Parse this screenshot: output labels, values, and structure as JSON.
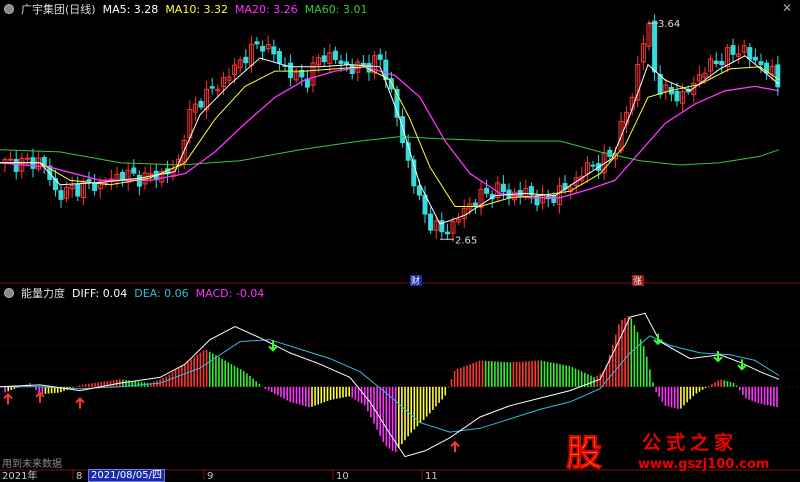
{
  "main_legend": {
    "title": "广宇集团(日线)",
    "ma5": "MA5: 3.28",
    "ma10": "MA10: 3.32",
    "ma20": "MA20: 3.26",
    "ma60": "MA60: 3.01"
  },
  "indicator_legend": {
    "name": "能量力度",
    "diff": "DIFF: 0.04",
    "dea": "DEA: 0.06",
    "macd": "MACD: -0.04"
  },
  "annotations": {
    "high": "3.64",
    "low": "2.65",
    "cai_badge": "财",
    "zhang_badge": "涨"
  },
  "footnote": "用到未来数据",
  "x_axis": {
    "year": "2021年",
    "m8": "8",
    "m9": "9",
    "m10": "10",
    "m11": "11",
    "crosshair_date": "2021/08/05/四"
  },
  "logo": {
    "stock_char": "股",
    "title": "公式之家",
    "url": "www.gszj100.com"
  },
  "colors": {
    "ma5": "#ffffff",
    "ma10": "#ffff33",
    "ma20": "#ff33ff",
    "ma60": "#33cc33",
    "up": "#ff3333",
    "down": "#33dddd",
    "diff": "#ffffff",
    "dea": "#33bbdd"
  },
  "chart_data": [
    {
      "type": "candlestick",
      "title": "广宇集团(日线)",
      "ylim": [
        2.5,
        3.7
      ],
      "price_path": [
        [
          0,
          3.0
        ],
        [
          20,
          3.0
        ],
        [
          40,
          3.01
        ],
        [
          55,
          2.85
        ],
        [
          70,
          2.88
        ],
        [
          85,
          2.9
        ],
        [
          100,
          2.9
        ],
        [
          120,
          2.95
        ],
        [
          140,
          2.93
        ],
        [
          160,
          2.95
        ],
        [
          175,
          2.97
        ],
        [
          185,
          3.2
        ],
        [
          200,
          3.3
        ],
        [
          215,
          3.35
        ],
        [
          230,
          3.42
        ],
        [
          245,
          3.5
        ],
        [
          260,
          3.55
        ],
        [
          275,
          3.48
        ],
        [
          290,
          3.4
        ],
        [
          305,
          3.38
        ],
        [
          320,
          3.5
        ],
        [
          335,
          3.47
        ],
        [
          350,
          3.43
        ],
        [
          365,
          3.45
        ],
        [
          380,
          3.47
        ],
        [
          392,
          3.28
        ],
        [
          400,
          3.1
        ],
        [
          410,
          2.95
        ],
        [
          420,
          2.78
        ],
        [
          430,
          2.72
        ],
        [
          440,
          2.68
        ],
        [
          452,
          2.72
        ],
        [
          465,
          2.8
        ],
        [
          480,
          2.85
        ],
        [
          495,
          2.88
        ],
        [
          510,
          2.85
        ],
        [
          525,
          2.87
        ],
        [
          540,
          2.82
        ],
        [
          555,
          2.86
        ],
        [
          570,
          2.9
        ],
        [
          585,
          2.98
        ],
        [
          600,
          3.0
        ],
        [
          612,
          3.05
        ],
        [
          620,
          3.18
        ],
        [
          630,
          3.3
        ],
        [
          640,
          3.55
        ],
        [
          648,
          3.62
        ],
        [
          652,
          3.43
        ],
        [
          660,
          3.32
        ],
        [
          670,
          3.32
        ],
        [
          680,
          3.3
        ],
        [
          690,
          3.35
        ],
        [
          700,
          3.42
        ],
        [
          710,
          3.45
        ],
        [
          720,
          3.48
        ],
        [
          730,
          3.5
        ],
        [
          740,
          3.53
        ],
        [
          750,
          3.47
        ],
        [
          760,
          3.45
        ],
        [
          770,
          3.41
        ],
        [
          779,
          3.33
        ]
      ],
      "ma5": [
        [
          0,
          3.0
        ],
        [
          40,
          3.0
        ],
        [
          60,
          2.9
        ],
        [
          100,
          2.91
        ],
        [
          140,
          2.93
        ],
        [
          175,
          2.96
        ],
        [
          200,
          3.22
        ],
        [
          230,
          3.36
        ],
        [
          260,
          3.48
        ],
        [
          290,
          3.44
        ],
        [
          320,
          3.44
        ],
        [
          350,
          3.45
        ],
        [
          380,
          3.44
        ],
        [
          400,
          3.2
        ],
        [
          420,
          2.9
        ],
        [
          440,
          2.72
        ],
        [
          465,
          2.76
        ],
        [
          495,
          2.85
        ],
        [
          525,
          2.86
        ],
        [
          555,
          2.85
        ],
        [
          585,
          2.94
        ],
        [
          612,
          3.02
        ],
        [
          630,
          3.22
        ],
        [
          648,
          3.45
        ],
        [
          665,
          3.38
        ],
        [
          690,
          3.33
        ],
        [
          720,
          3.43
        ],
        [
          745,
          3.49
        ],
        [
          779,
          3.36
        ]
      ],
      "ma10": [
        [
          0,
          3.0
        ],
        [
          40,
          3.0
        ],
        [
          70,
          2.92
        ],
        [
          110,
          2.9
        ],
        [
          150,
          2.93
        ],
        [
          185,
          3.0
        ],
        [
          215,
          3.2
        ],
        [
          245,
          3.35
        ],
        [
          275,
          3.42
        ],
        [
          305,
          3.42
        ],
        [
          335,
          3.43
        ],
        [
          365,
          3.44
        ],
        [
          390,
          3.38
        ],
        [
          410,
          3.2
        ],
        [
          430,
          2.98
        ],
        [
          455,
          2.8
        ],
        [
          480,
          2.8
        ],
        [
          510,
          2.84
        ],
        [
          540,
          2.85
        ],
        [
          570,
          2.87
        ],
        [
          600,
          2.95
        ],
        [
          625,
          3.08
        ],
        [
          648,
          3.3
        ],
        [
          670,
          3.33
        ],
        [
          700,
          3.36
        ],
        [
          730,
          3.43
        ],
        [
          760,
          3.44
        ],
        [
          779,
          3.38
        ]
      ],
      "ma20": [
        [
          0,
          3.0
        ],
        [
          50,
          2.98
        ],
        [
          100,
          2.92
        ],
        [
          150,
          2.92
        ],
        [
          185,
          2.95
        ],
        [
          215,
          3.05
        ],
        [
          245,
          3.18
        ],
        [
          275,
          3.3
        ],
        [
          305,
          3.38
        ],
        [
          335,
          3.42
        ],
        [
          365,
          3.44
        ],
        [
          395,
          3.4
        ],
        [
          420,
          3.3
        ],
        [
          445,
          3.1
        ],
        [
          470,
          2.95
        ],
        [
          500,
          2.86
        ],
        [
          530,
          2.84
        ],
        [
          560,
          2.84
        ],
        [
          590,
          2.88
        ],
        [
          615,
          2.92
        ],
        [
          640,
          3.05
        ],
        [
          665,
          3.18
        ],
        [
          695,
          3.27
        ],
        [
          725,
          3.33
        ],
        [
          755,
          3.35
        ],
        [
          779,
          3.33
        ]
      ],
      "ma60": [
        [
          0,
          3.06
        ],
        [
          60,
          3.05
        ],
        [
          120,
          3.0
        ],
        [
          180,
          2.99
        ],
        [
          240,
          3.01
        ],
        [
          300,
          3.06
        ],
        [
          360,
          3.1
        ],
        [
          400,
          3.12
        ],
        [
          440,
          3.11
        ],
        [
          500,
          3.1
        ],
        [
          560,
          3.1
        ],
        [
          600,
          3.05
        ],
        [
          640,
          3.01
        ],
        [
          680,
          2.99
        ],
        [
          720,
          3.0
        ],
        [
          760,
          3.03
        ],
        [
          779,
          3.06
        ]
      ],
      "high_label": {
        "x": 648,
        "price": 3.64,
        "text": "3.64"
      },
      "low_label": {
        "x": 440,
        "price": 2.65,
        "text": "2.65"
      }
    },
    {
      "type": "bar",
      "title": "能量力度",
      "ylim": [
        -0.42,
        0.45
      ],
      "diff": [
        [
          0,
          0.0
        ],
        [
          40,
          0.01
        ],
        [
          80,
          -0.02
        ],
        [
          120,
          0.02
        ],
        [
          160,
          0.05
        ],
        [
          185,
          0.12
        ],
        [
          210,
          0.25
        ],
        [
          235,
          0.32
        ],
        [
          260,
          0.26
        ],
        [
          290,
          0.18
        ],
        [
          320,
          0.12
        ],
        [
          350,
          0.05
        ],
        [
          370,
          -0.08
        ],
        [
          390,
          -0.25
        ],
        [
          405,
          -0.37
        ],
        [
          425,
          -0.34
        ],
        [
          450,
          -0.27
        ],
        [
          480,
          -0.16
        ],
        [
          510,
          -0.1
        ],
        [
          540,
          -0.06
        ],
        [
          570,
          -0.02
        ],
        [
          600,
          0.04
        ],
        [
          615,
          0.2
        ],
        [
          630,
          0.37
        ],
        [
          645,
          0.39
        ],
        [
          660,
          0.24
        ],
        [
          690,
          0.15
        ],
        [
          720,
          0.17
        ],
        [
          740,
          0.13
        ],
        [
          760,
          0.08
        ],
        [
          779,
          0.04
        ]
      ],
      "dea": [
        [
          0,
          0.0
        ],
        [
          40,
          0.0
        ],
        [
          80,
          -0.01
        ],
        [
          120,
          0.0
        ],
        [
          160,
          0.02
        ],
        [
          200,
          0.1
        ],
        [
          240,
          0.24
        ],
        [
          270,
          0.25
        ],
        [
          300,
          0.2
        ],
        [
          330,
          0.15
        ],
        [
          360,
          0.08
        ],
        [
          390,
          -0.05
        ],
        [
          420,
          -0.19
        ],
        [
          450,
          -0.24
        ],
        [
          480,
          -0.22
        ],
        [
          510,
          -0.17
        ],
        [
          540,
          -0.12
        ],
        [
          570,
          -0.08
        ],
        [
          600,
          -0.01
        ],
        [
          630,
          0.18
        ],
        [
          650,
          0.27
        ],
        [
          670,
          0.22
        ],
        [
          700,
          0.18
        ],
        [
          730,
          0.17
        ],
        [
          755,
          0.14
        ],
        [
          779,
          0.06
        ]
      ],
      "macd": [
        [
          0,
          0.02
        ],
        [
          5,
          -0.03
        ],
        [
          30,
          0.02
        ],
        [
          40,
          -0.04
        ],
        [
          60,
          -0.03
        ],
        [
          80,
          0.01
        ],
        [
          120,
          0.04
        ],
        [
          150,
          0.02
        ],
        [
          165,
          0.05
        ],
        [
          190,
          0.14
        ],
        [
          205,
          0.2
        ],
        [
          225,
          0.14
        ],
        [
          245,
          0.08
        ],
        [
          265,
          -0.01
        ],
        [
          290,
          -0.08
        ],
        [
          310,
          -0.11
        ],
        [
          330,
          -0.07
        ],
        [
          350,
          -0.05
        ],
        [
          365,
          -0.1
        ],
        [
          385,
          -0.31
        ],
        [
          395,
          -0.35
        ],
        [
          410,
          -0.25
        ],
        [
          430,
          -0.14
        ],
        [
          445,
          -0.05
        ],
        [
          455,
          0.09
        ],
        [
          480,
          0.14
        ],
        [
          510,
          0.13
        ],
        [
          540,
          0.14
        ],
        [
          570,
          0.11
        ],
        [
          595,
          0.05
        ],
        [
          605,
          0.09
        ],
        [
          620,
          0.35
        ],
        [
          630,
          0.38
        ],
        [
          645,
          0.2
        ],
        [
          655,
          -0.02
        ],
        [
          665,
          -0.1
        ],
        [
          680,
          -0.12
        ],
        [
          695,
          -0.04
        ],
        [
          720,
          0.04
        ],
        [
          735,
          0.02
        ],
        [
          745,
          -0.06
        ],
        [
          760,
          -0.09
        ],
        [
          779,
          -0.11
        ]
      ],
      "up_arrows": [
        273,
        658,
        718,
        742
      ],
      "down_arrows": [
        8,
        40,
        80,
        455
      ]
    }
  ]
}
